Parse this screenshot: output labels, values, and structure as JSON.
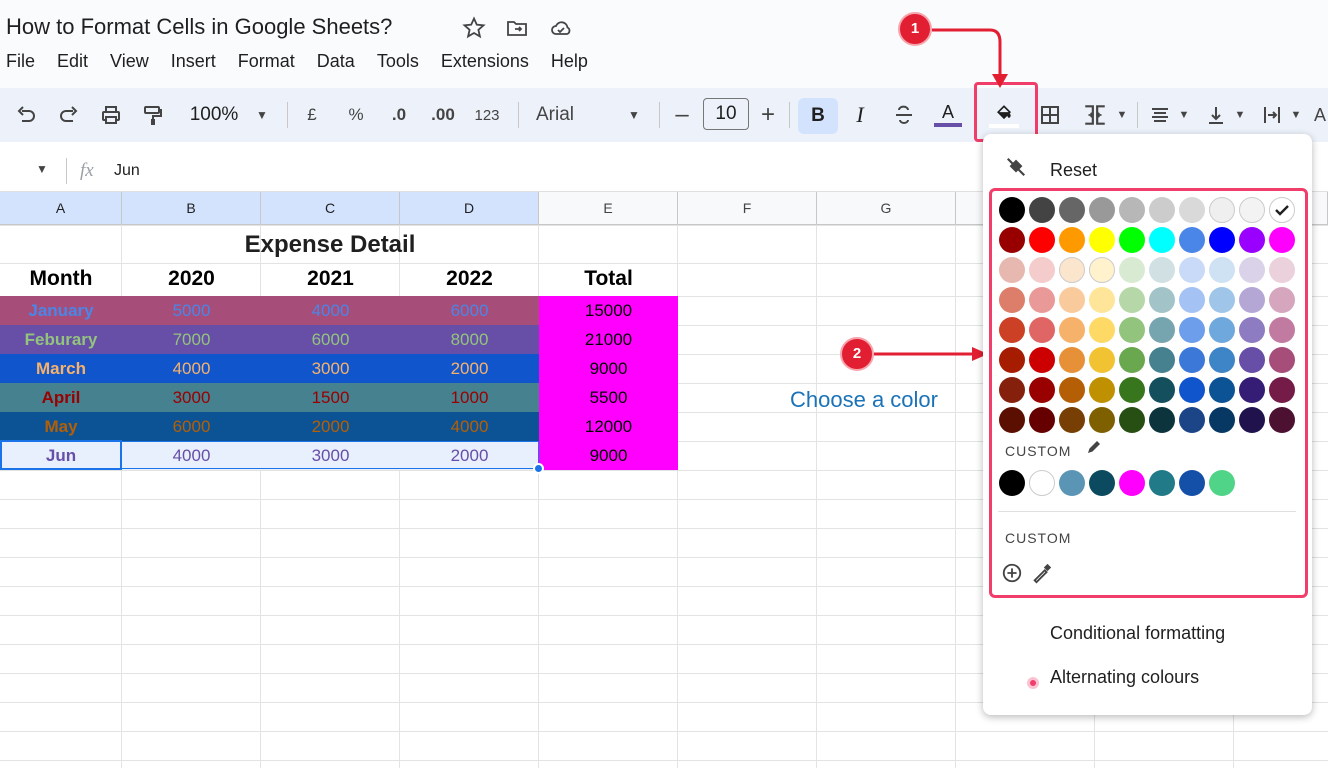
{
  "doc": {
    "title": "How to Format Cells in Google Sheets?"
  },
  "menu": [
    "File",
    "Edit",
    "View",
    "Insert",
    "Format",
    "Data",
    "Tools",
    "Extensions",
    "Help"
  ],
  "toolbar": {
    "zoom": "100%",
    "currency": "£",
    "percent": "%",
    "dec_decrease": ".0",
    "dec_increase": ".00",
    "number_format": "123",
    "font": "Arial",
    "font_size": "10",
    "bold": "B",
    "italic": "I",
    "text_color_label": "A",
    "text_color": "#674ea7"
  },
  "formula_bar": {
    "fx": "fx",
    "value": "Jun"
  },
  "columns": [
    "A",
    "B",
    "C",
    "D",
    "E",
    "F",
    "G"
  ],
  "sheet": {
    "title": "Expense Detail",
    "headers": [
      "Month",
      "2020",
      "2021",
      "2022",
      "Total"
    ],
    "rows": [
      {
        "cells": [
          "January",
          "5000",
          "4000",
          "6000",
          "15000"
        ],
        "bg": "#a64d79",
        "month_color": "#4a86e8",
        "num_color": "#4a86e8"
      },
      {
        "cells": [
          "Feburary",
          "7000",
          "6000",
          "8000",
          "21000"
        ],
        "bg": "#674ea7",
        "month_color": "#93c47d",
        "num_color": "#93c47d"
      },
      {
        "cells": [
          "March",
          "4000",
          "3000",
          "2000",
          "9000"
        ],
        "bg": "#1155cc",
        "month_color": "#f6b26b",
        "num_color": "#f6b26b"
      },
      {
        "cells": [
          "April",
          "3000",
          "1500",
          "1000",
          "5500"
        ],
        "bg": "#45818e",
        "month_color": "#990000",
        "num_color": "#990000"
      },
      {
        "cells": [
          "May",
          "6000",
          "2000",
          "4000",
          "12000"
        ],
        "bg": "#0b5394",
        "month_color": "#b45f06",
        "num_color": "#b45f06"
      },
      {
        "cells": [
          "Jun",
          "4000",
          "3000",
          "2000",
          "9000"
        ],
        "bg": "#e8f0fe",
        "month_color": "#674ea7",
        "num_color": "#674ea7"
      }
    ],
    "total_bg": "#ff00ff"
  },
  "palette": {
    "reset_label": "Reset",
    "grid": [
      [
        "#000000",
        "#434343",
        "#666666",
        "#999999",
        "#b7b7b7",
        "#cccccc",
        "#d9d9d9",
        "#efefef",
        "#f3f3f3",
        "#ffffff"
      ],
      [
        "#980000",
        "#ff0000",
        "#ff9900",
        "#ffff00",
        "#00ff00",
        "#00ffff",
        "#4a86e8",
        "#0000ff",
        "#9900ff",
        "#ff00ff"
      ],
      [
        "#e6b8af",
        "#f4cccc",
        "#fce5cd",
        "#fff2cc",
        "#d9ead3",
        "#d0e0e3",
        "#c9daf8",
        "#cfe2f3",
        "#d9d2e9",
        "#ead1dc"
      ],
      [
        "#dd7e6b",
        "#ea9999",
        "#f9cb9c",
        "#ffe599",
        "#b6d7a8",
        "#a2c4c9",
        "#a4c2f4",
        "#9fc5e8",
        "#b4a7d6",
        "#d5a6bd"
      ],
      [
        "#cc4125",
        "#e06666",
        "#f6b26b",
        "#ffd966",
        "#93c47d",
        "#76a5af",
        "#6d9eeb",
        "#6fa8dc",
        "#8e7cc3",
        "#c27ba0"
      ],
      [
        "#a61c00",
        "#cc0000",
        "#e69138",
        "#f1c232",
        "#6aa84f",
        "#45818e",
        "#3c78d8",
        "#3d85c6",
        "#674ea7",
        "#a64d79"
      ],
      [
        "#85200c",
        "#990000",
        "#b45f06",
        "#bf9000",
        "#38761d",
        "#134f5c",
        "#1155cc",
        "#0b5394",
        "#351c75",
        "#741b47"
      ],
      [
        "#5b0f00",
        "#660000",
        "#783f04",
        "#7f6000",
        "#274e13",
        "#0c343d",
        "#1c4587",
        "#073763",
        "#20124d",
        "#4c1130"
      ]
    ],
    "custom1_label": "CUSTOM",
    "custom_colors": [
      "#000000",
      "#ffffff",
      "#5b95b5",
      "#0b4a5f",
      "#ff00ff",
      "#217a88",
      "#1450a8",
      "#4fd488"
    ],
    "custom2_label": "CUSTOM",
    "conditional": "Conditional formatting",
    "alternating": "Alternating colours"
  },
  "annotations": {
    "badge1": "1",
    "badge2": "2",
    "choose": "Choose a color",
    "highlight_color": "#f03d6a"
  }
}
